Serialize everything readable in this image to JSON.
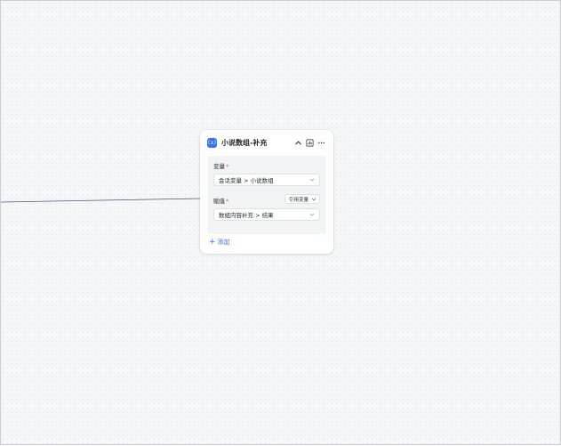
{
  "node": {
    "icon_text": "(x)",
    "title": "小说数组-补充",
    "actions": {
      "collapse_icon": "chevron-up-icon",
      "stats_icon": "chart-icon",
      "more_icon": "more-icon"
    }
  },
  "fields": {
    "variable": {
      "label": "变量",
      "required_mark": "*",
      "value": "会话变量 > 小说数组"
    },
    "assign": {
      "label": "赋值",
      "required_mark": "*",
      "mode": "引用变量",
      "value": "数组内容补充 > 结果"
    }
  },
  "add_button": {
    "icon": "+",
    "label": "添加"
  },
  "colors": {
    "accent": "#3370ff",
    "required": "#f54a45",
    "canvas": "#f5f6f8"
  }
}
